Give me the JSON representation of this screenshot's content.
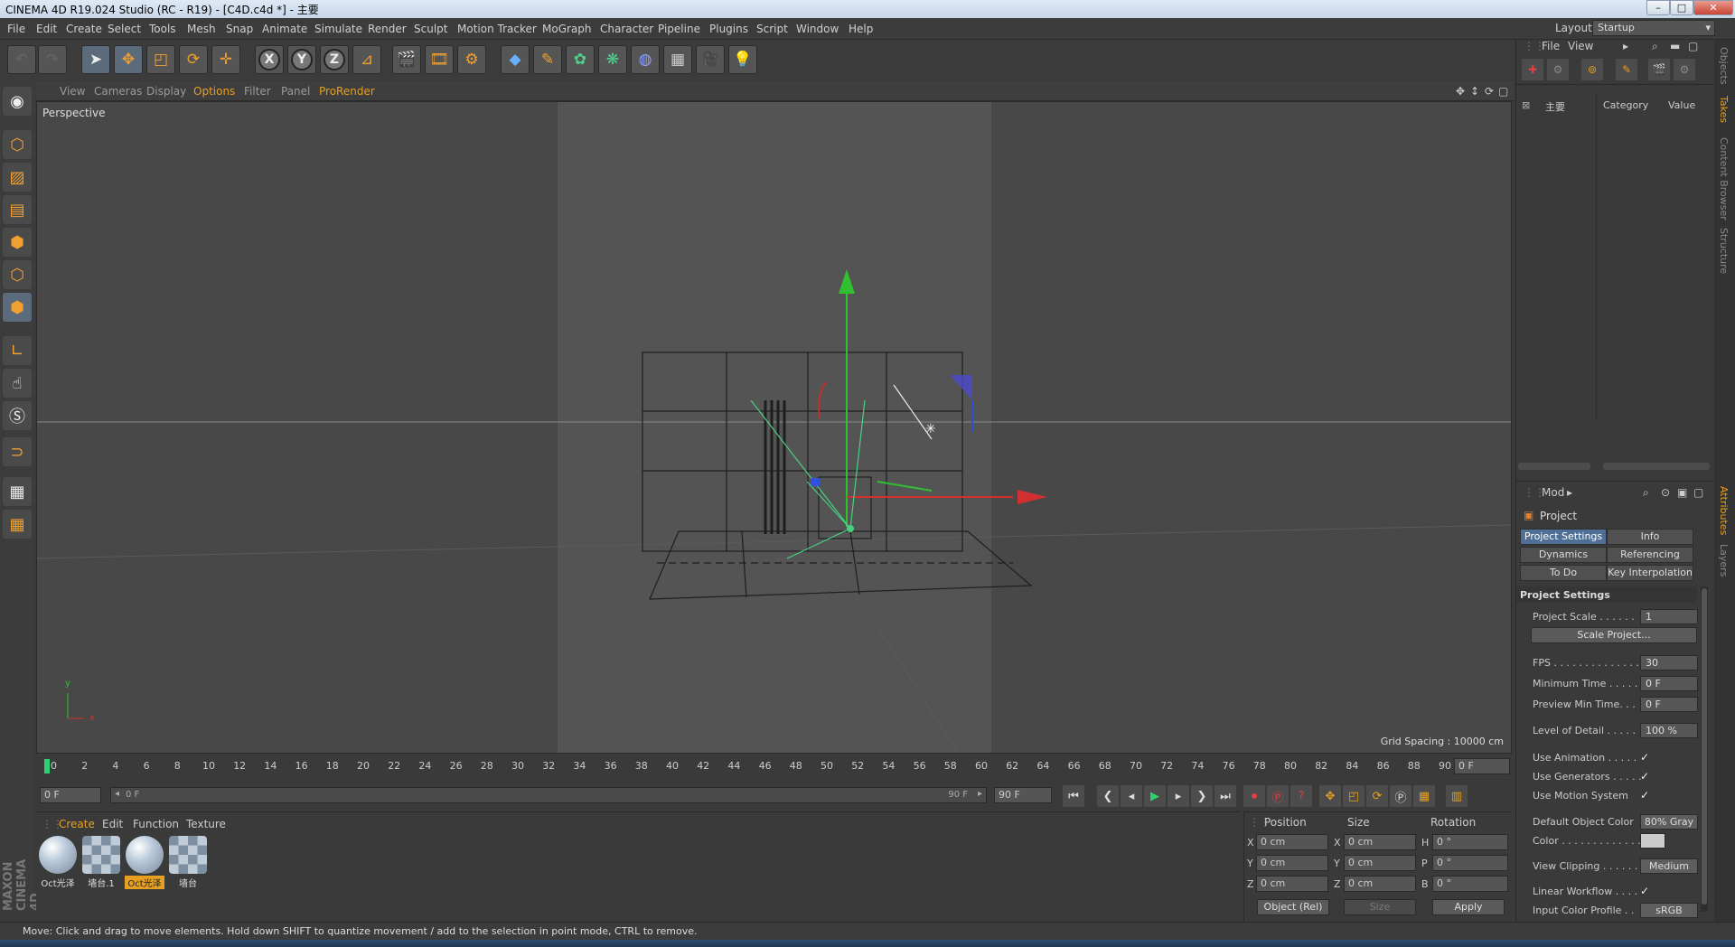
{
  "window": {
    "title": "CINEMA 4D R19.024 Studio (RC - R19) - [C4D.c4d *] - 主要",
    "controls": [
      "–",
      "□",
      "✕"
    ]
  },
  "menubar": {
    "items": [
      "File",
      "Edit",
      "Create",
      "Select",
      "Tools",
      "Mesh",
      "Snap",
      "Animate",
      "Simulate",
      "Render",
      "Sculpt",
      "Motion Tracker",
      "MoGraph",
      "Character",
      "Pipeline",
      "Plugins",
      "Script",
      "Window",
      "Help"
    ],
    "layout_label": "Layout:",
    "layout_value": "Startup"
  },
  "toolbar": {
    "axis_labels": [
      "X",
      "Y",
      "Z"
    ]
  },
  "viewport": {
    "menu": [
      "View",
      "Cameras",
      "Display",
      "Options",
      "Filter",
      "Panel",
      "ProRender"
    ],
    "label": "Perspective",
    "grid_spacing": "Grid Spacing : 10000 cm",
    "axis_labels": {
      "y": "y",
      "x": "x"
    }
  },
  "timeline": {
    "ticks": [
      "0",
      "2",
      "4",
      "6",
      "8",
      "10",
      "12",
      "14",
      "16",
      "18",
      "20",
      "22",
      "24",
      "26",
      "28",
      "30",
      "32",
      "34",
      "36",
      "38",
      "40",
      "42",
      "44",
      "46",
      "48",
      "50",
      "52",
      "54",
      "56",
      "58",
      "60",
      "62",
      "64",
      "66",
      "68",
      "70",
      "72",
      "74",
      "76",
      "78",
      "80",
      "82",
      "84",
      "86",
      "88",
      "90"
    ],
    "current_frame": "0 F",
    "start_frame": "0 F",
    "slider_start": "0 F",
    "slider_end": "90 F",
    "end_frame": "90 F"
  },
  "materials": {
    "menu": [
      "Create",
      "Edit",
      "Function",
      "Texture"
    ],
    "items": [
      {
        "label": "Oct光泽",
        "style": "ball",
        "selected": false
      },
      {
        "label": "墙台.1",
        "style": "checker",
        "selected": false
      },
      {
        "label": "Oct光泽",
        "style": "ball",
        "selected": true
      },
      {
        "label": "墙台",
        "style": "checker",
        "selected": false
      }
    ]
  },
  "coordinates": {
    "headers": [
      "Position",
      "Size",
      "Rotation"
    ],
    "rows": [
      {
        "pl": "X",
        "pv": "0 cm",
        "sl": "X",
        "sv": "0 cm",
        "rl": "H",
        "rv": "0 °"
      },
      {
        "pl": "Y",
        "pv": "0 cm",
        "sl": "Y",
        "sv": "0 cm",
        "rl": "P",
        "rv": "0 °"
      },
      {
        "pl": "Z",
        "pv": "0 cm",
        "sl": "Z",
        "sv": "0 cm",
        "rl": "B",
        "rv": "0 °"
      }
    ],
    "mode_select": "Object (Rel)",
    "size_select": "Size",
    "apply_label": "Apply"
  },
  "objects_panel": {
    "menu": [
      "File",
      "View"
    ],
    "tree_item": "主要",
    "columns": [
      "Category",
      "Value"
    ]
  },
  "attributes": {
    "menu": "Mod",
    "header": "Project",
    "tabs": [
      "Project Settings",
      "Info",
      "Dynamics",
      "Referencing",
      "To Do",
      "Key Interpolation"
    ],
    "section_title": "Project Settings",
    "rows": [
      {
        "label": "Project Scale . . . . . .",
        "value": "1",
        "kind": "val"
      },
      {
        "label": "Scale Project...",
        "kind": "wide"
      },
      {
        "label": "FPS . . . . . . . . . . . . . . .",
        "value": "30",
        "kind": "val"
      },
      {
        "label": "Minimum Time . . . . .",
        "value": "0 F",
        "kind": "val"
      },
      {
        "label": "Preview Min Time. . .",
        "value": "0 F",
        "kind": "val"
      },
      {
        "label": "Level of Detail . . . . .",
        "value": "100 %",
        "kind": "val"
      },
      {
        "label": "Use Animation . . . . .",
        "value": "✓",
        "kind": "chk"
      },
      {
        "label": "Use Generators . . . . .",
        "value": "✓",
        "kind": "chk"
      },
      {
        "label": "Use Motion System",
        "value": "✓",
        "kind": "chk"
      },
      {
        "label": "Default Object Color",
        "value": "80% Gray",
        "kind": "btn"
      },
      {
        "label": "Color . . . . . . . . . . . . .",
        "value": "",
        "kind": "swatch"
      },
      {
        "label": "View Clipping . . . . . .",
        "value": "Medium",
        "kind": "btn"
      },
      {
        "label": "Linear Workflow . . . .",
        "value": "✓",
        "kind": "chk"
      },
      {
        "label": "Input Color Profile . .",
        "value": "sRGB",
        "kind": "btn"
      }
    ]
  },
  "side_tabs": [
    "Objects",
    "Takes",
    "Content Browser",
    "Structure",
    "Attributes",
    "Layers"
  ],
  "status": {
    "text": "Move: Click and drag to move elements. Hold down SHIFT to quantize movement / add to the selection in point mode, CTRL to remove."
  },
  "brand": {
    "logo_text": "MAXON CINEMA 4D"
  },
  "colors": {
    "accent": "#e6a020",
    "active_tab": "#4f6f97",
    "x_axis": "#d23030",
    "y_axis": "#30c030",
    "z_axis": "#3050d0"
  }
}
